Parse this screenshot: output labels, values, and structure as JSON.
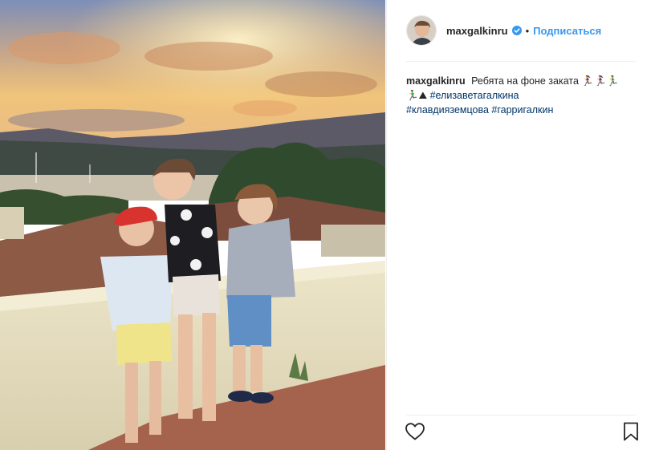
{
  "post": {
    "username": "maxgalkinru",
    "dot": "•",
    "follow_label": "Подписаться",
    "caption": {
      "username": "maxgalkinru",
      "text": "Ребята на фоне заката 🏃‍♀️🏃‍♀️🏃‍♂️🏃‍♂️⛰",
      "hashtags": [
        "#елизаветагалкина",
        "#клавдияземцова",
        "#гарригалкин"
      ]
    }
  },
  "icons": {
    "verified": "verified-badge-icon",
    "like": "heart-icon",
    "save": "bookmark-icon"
  },
  "colors": {
    "link": "#3897f0",
    "hashtag": "#003569",
    "verified": "#3897f0"
  }
}
